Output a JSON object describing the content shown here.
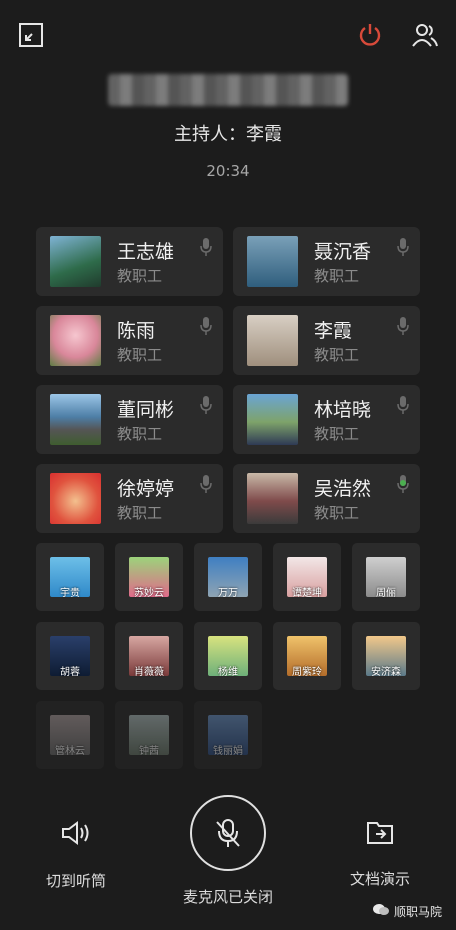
{
  "header": {
    "title_blurred": "",
    "host_label": "主持人：李霞",
    "timer": "20:34"
  },
  "colors": {
    "background": "#1c1c1c",
    "card": "#2b2b2b",
    "power_icon": "#d74a3a",
    "mic_active": "#4caf50"
  },
  "participants_large": [
    {
      "name": "王志雄",
      "role": "教职工",
      "mic": "muted",
      "icon": "mic-icon"
    },
    {
      "name": "聂沉香",
      "role": "教职工",
      "mic": "muted",
      "icon": "mic-icon"
    },
    {
      "name": "陈雨",
      "role": "教职工",
      "mic": "muted",
      "icon": "mic-icon"
    },
    {
      "name": "李霞",
      "role": "教职工",
      "mic": "muted",
      "icon": "mic-icon"
    },
    {
      "name": "董同彬",
      "role": "教职工",
      "mic": "muted",
      "icon": "mic-icon"
    },
    {
      "name": "林培晓",
      "role": "教职工",
      "mic": "muted",
      "icon": "mic-icon"
    },
    {
      "name": "徐婷婷",
      "role": "教职工",
      "mic": "muted",
      "icon": "mic-icon"
    },
    {
      "name": "吴浩然",
      "role": "教职工",
      "mic": "active",
      "icon": "mic-icon"
    }
  ],
  "participants_small": [
    {
      "name": "宇贵"
    },
    {
      "name": "苏妙云"
    },
    {
      "name": "万万"
    },
    {
      "name": "谭楚坤"
    },
    {
      "name": "周俪"
    },
    {
      "name": "胡蓉"
    },
    {
      "name": "肖薇薇"
    },
    {
      "name": "杨维"
    },
    {
      "name": "周紫玲"
    },
    {
      "name": "安济森"
    },
    {
      "name": "管林云"
    },
    {
      "name": "钟茜"
    },
    {
      "name": "钱丽娟"
    }
  ],
  "controls": {
    "speaker_label": "切到听筒",
    "mic_label": "麦克风已关闭",
    "share_label": "文档演示"
  },
  "watermark": "顺职马院"
}
